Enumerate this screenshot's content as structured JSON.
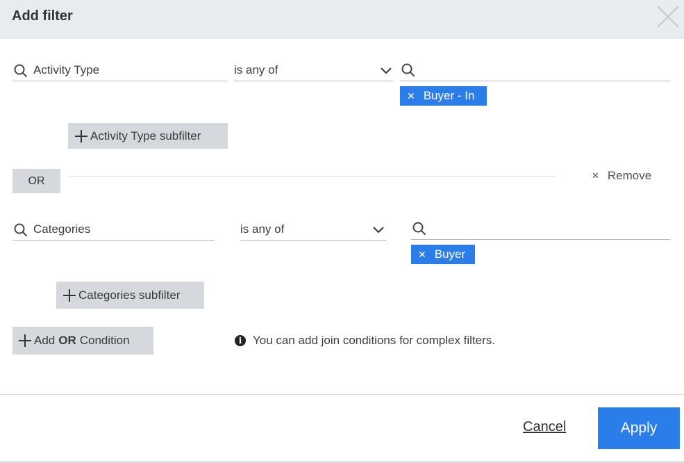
{
  "header": {
    "title": "Add filter"
  },
  "condition1": {
    "field": "Activity Type",
    "operator": "is any of",
    "value_placeholder": "",
    "chips": [
      "Buyer - In"
    ],
    "subfilter_label": "Activity Type subfilter"
  },
  "separator": {
    "or_label": "OR",
    "remove_label": "Remove"
  },
  "condition2": {
    "field": "Categories",
    "operator": "is any of",
    "value_placeholder": "",
    "chips": [
      "Buyer"
    ],
    "subfilter_label": "Categories subfilter"
  },
  "add_condition": {
    "prefix": "Add",
    "keyword": "OR",
    "suffix": "Condition"
  },
  "info": {
    "text": "You can add join conditions for complex filters.",
    "icon": "info-icon"
  },
  "footer": {
    "cancel_label": "Cancel",
    "apply_label": "Apply"
  },
  "colors": {
    "accent": "#2b7de9",
    "header_bg": "#e8ebef",
    "button_grey": "#d5d8dd"
  }
}
